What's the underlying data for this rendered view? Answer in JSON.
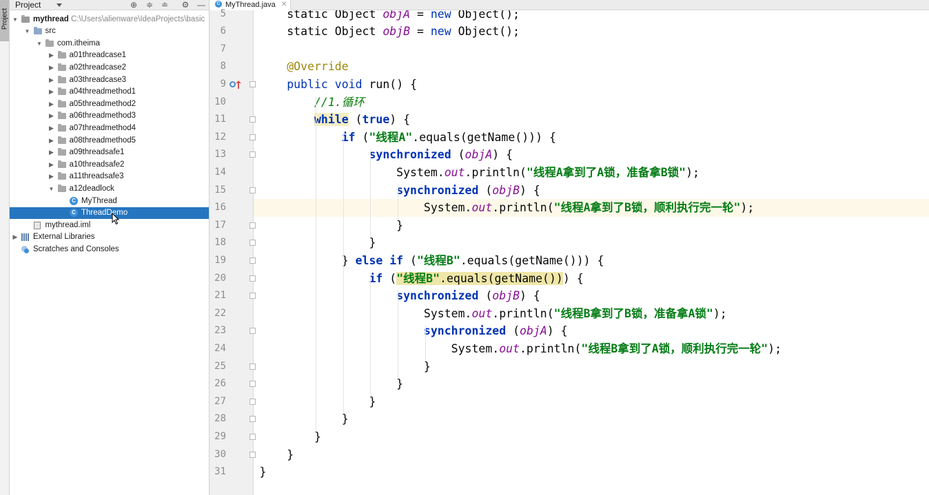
{
  "tool_strip": {
    "project_tab_label": "Project"
  },
  "project_panel": {
    "header_title": "Project",
    "tree": [
      {
        "id": "mythread",
        "label": "mythread",
        "path": "C:\\Users\\alienware\\IdeaProjects\\basic",
        "kind": "module",
        "depth": 0,
        "expanded": true
      },
      {
        "id": "src",
        "label": "src",
        "kind": "src",
        "depth": 1,
        "expanded": true
      },
      {
        "id": "com-itheima",
        "label": "com.itheima",
        "kind": "package",
        "depth": 2,
        "expanded": true
      },
      {
        "id": "a01threadcase1",
        "label": "a01threadcase1",
        "kind": "package",
        "depth": 3,
        "expanded": false
      },
      {
        "id": "a02threadcase2",
        "label": "a02threadcase2",
        "kind": "package",
        "depth": 3,
        "expanded": false
      },
      {
        "id": "a03threadcase3",
        "label": "a03threadcase3",
        "kind": "package",
        "depth": 3,
        "expanded": false
      },
      {
        "id": "a04threadmethod1",
        "label": "a04threadmethod1",
        "kind": "package",
        "depth": 3,
        "expanded": false
      },
      {
        "id": "a05threadmethod2",
        "label": "a05threadmethod2",
        "kind": "package",
        "depth": 3,
        "expanded": false
      },
      {
        "id": "a06threadmethod3",
        "label": "a06threadmethod3",
        "kind": "package",
        "depth": 3,
        "expanded": false
      },
      {
        "id": "a07threadmethod4",
        "label": "a07threadmethod4",
        "kind": "package",
        "depth": 3,
        "expanded": false
      },
      {
        "id": "a08threadmethod5",
        "label": "a08threadmethod5",
        "kind": "package",
        "depth": 3,
        "expanded": false
      },
      {
        "id": "a09threadsafe1",
        "label": "a09threadsafe1",
        "kind": "package",
        "depth": 3,
        "expanded": false
      },
      {
        "id": "a10threadsafe2",
        "label": "a10threadsafe2",
        "kind": "package",
        "depth": 3,
        "expanded": false
      },
      {
        "id": "a11threadsafe3",
        "label": "a11threadsafe3",
        "kind": "package",
        "depth": 3,
        "expanded": false
      },
      {
        "id": "a12deadlock",
        "label": "a12deadlock",
        "kind": "package",
        "depth": 3,
        "expanded": true
      },
      {
        "id": "MyThread",
        "label": "MyThread",
        "kind": "class",
        "depth": 4
      },
      {
        "id": "ThreadDemo",
        "label": "ThreadDemo",
        "kind": "class",
        "depth": 4,
        "selected": true
      },
      {
        "id": "mythread-iml",
        "label": "mythread.iml",
        "kind": "iml",
        "depth": 1
      },
      {
        "id": "external-libraries",
        "label": "External Libraries",
        "kind": "libs",
        "depth": 0,
        "expanded": false
      },
      {
        "id": "scratches",
        "label": "Scratches and Consoles",
        "kind": "scratch",
        "depth": 0
      }
    ]
  },
  "editor": {
    "active_tab": "MyThread.java",
    "caret_line": 16,
    "colors": {
      "keyword": "#0033b3",
      "string": "#067d17",
      "field": "#871094",
      "annotation": "#9e880d",
      "selection": "#2675bf",
      "caret_row": "#fdf8e8"
    },
    "lines": [
      {
        "n": "5",
        "tokens": [
          [
            "ident",
            "    static Object "
          ],
          [
            "static-field",
            "objA"
          ],
          [
            "ident",
            " = "
          ],
          [
            "kw-plain",
            "new"
          ],
          [
            "ident",
            " Object();"
          ]
        ]
      },
      {
        "n": "6",
        "tokens": [
          [
            "ident",
            "    static Object "
          ],
          [
            "static-field",
            "objB"
          ],
          [
            "ident",
            " = "
          ],
          [
            "kw-plain",
            "new"
          ],
          [
            "ident",
            " Object();"
          ]
        ]
      },
      {
        "n": "7",
        "tokens": []
      },
      {
        "n": "8",
        "tokens": [
          [
            "anno",
            "    @Override"
          ]
        ]
      },
      {
        "n": "9",
        "tokens": [
          [
            "ident",
            "    "
          ],
          [
            "kw-plain",
            "public void"
          ],
          [
            "ident",
            " run() {"
          ]
        ]
      },
      {
        "n": "10",
        "tokens": [
          [
            "cmt",
            "        //1.循环"
          ]
        ]
      },
      {
        "n": "11",
        "tokens": [
          [
            "ident",
            "        "
          ],
          [
            "kw hl-word",
            "while"
          ],
          [
            "ident",
            " ("
          ],
          [
            "kw",
            "true"
          ],
          [
            "ident",
            ") {"
          ]
        ]
      },
      {
        "n": "12",
        "tokens": [
          [
            "ident",
            "            "
          ],
          [
            "kw",
            "if"
          ],
          [
            "ident",
            " ("
          ],
          [
            "str",
            "\"线程A\""
          ],
          [
            "ident",
            ".equals(getName())) {"
          ]
        ]
      },
      {
        "n": "13",
        "tokens": [
          [
            "ident",
            "                "
          ],
          [
            "kw",
            "synchronized"
          ],
          [
            "ident",
            " ("
          ],
          [
            "static-field",
            "objA"
          ],
          [
            "ident",
            ") {"
          ]
        ]
      },
      {
        "n": "14",
        "tokens": [
          [
            "ident",
            "                    System."
          ],
          [
            "static-field",
            "out"
          ],
          [
            "ident",
            ".println("
          ],
          [
            "str",
            "\"线程A拿到了A锁，准备拿B锁\""
          ],
          [
            "ident",
            ");"
          ]
        ]
      },
      {
        "n": "15",
        "tokens": [
          [
            "ident",
            "                    "
          ],
          [
            "kw",
            "synchronized"
          ],
          [
            "ident",
            " ("
          ],
          [
            "static-field",
            "objB"
          ],
          [
            "ident",
            ") {"
          ]
        ]
      },
      {
        "n": "16",
        "tokens": [
          [
            "ident",
            "                        System."
          ],
          [
            "static-field",
            "out"
          ],
          [
            "ident",
            ".println("
          ],
          [
            "str",
            "\"线程A拿到了B锁，顺利执行完一轮\""
          ],
          [
            "ident",
            ");"
          ]
        ]
      },
      {
        "n": "17",
        "tokens": [
          [
            "ident",
            "                    }"
          ]
        ]
      },
      {
        "n": "18",
        "tokens": [
          [
            "ident",
            "                }"
          ]
        ]
      },
      {
        "n": "19",
        "tokens": [
          [
            "ident",
            "            } "
          ],
          [
            "kw",
            "else if"
          ],
          [
            "ident",
            " ("
          ],
          [
            "str",
            "\"线程B\""
          ],
          [
            "ident",
            ".equals(getName())) {"
          ]
        ]
      },
      {
        "n": "20",
        "tokens": [
          [
            "ident",
            "                "
          ],
          [
            "kw",
            "if"
          ],
          [
            "ident",
            " ("
          ],
          [
            "str hl-match",
            "\"线程B\""
          ],
          [
            "ident hl-match",
            ".equals(getName())"
          ],
          [
            "ident",
            ") {"
          ]
        ]
      },
      {
        "n": "21",
        "tokens": [
          [
            "ident",
            "                    "
          ],
          [
            "kw",
            "synchronized"
          ],
          [
            "ident",
            " ("
          ],
          [
            "static-field",
            "objB"
          ],
          [
            "ident",
            ") {"
          ]
        ]
      },
      {
        "n": "22",
        "tokens": [
          [
            "ident",
            "                        System."
          ],
          [
            "static-field",
            "out"
          ],
          [
            "ident",
            ".println("
          ],
          [
            "str",
            "\"线程B拿到了B锁，准备拿A锁\""
          ],
          [
            "ident",
            ");"
          ]
        ]
      },
      {
        "n": "23",
        "tokens": [
          [
            "ident",
            "                        "
          ],
          [
            "kw",
            "synchronized"
          ],
          [
            "ident",
            " ("
          ],
          [
            "static-field",
            "objA"
          ],
          [
            "ident",
            ") {"
          ]
        ]
      },
      {
        "n": "24",
        "tokens": [
          [
            "ident",
            "                            System."
          ],
          [
            "static-field",
            "out"
          ],
          [
            "ident",
            ".println("
          ],
          [
            "str",
            "\"线程B拿到了A锁，顺利执行完一轮\""
          ],
          [
            "ident",
            ");"
          ]
        ]
      },
      {
        "n": "25",
        "tokens": [
          [
            "ident",
            "                        }"
          ]
        ]
      },
      {
        "n": "26",
        "tokens": [
          [
            "ident",
            "                    }"
          ]
        ]
      },
      {
        "n": "27",
        "tokens": [
          [
            "ident",
            "                }"
          ]
        ]
      },
      {
        "n": "28",
        "tokens": [
          [
            "ident",
            "            }"
          ]
        ]
      },
      {
        "n": "29",
        "tokens": [
          [
            "ident",
            "        }"
          ]
        ]
      },
      {
        "n": "30",
        "tokens": [
          [
            "ident",
            "    }"
          ]
        ]
      },
      {
        "n": "31",
        "tokens": [
          [
            "ident",
            "}"
          ]
        ]
      }
    ]
  }
}
